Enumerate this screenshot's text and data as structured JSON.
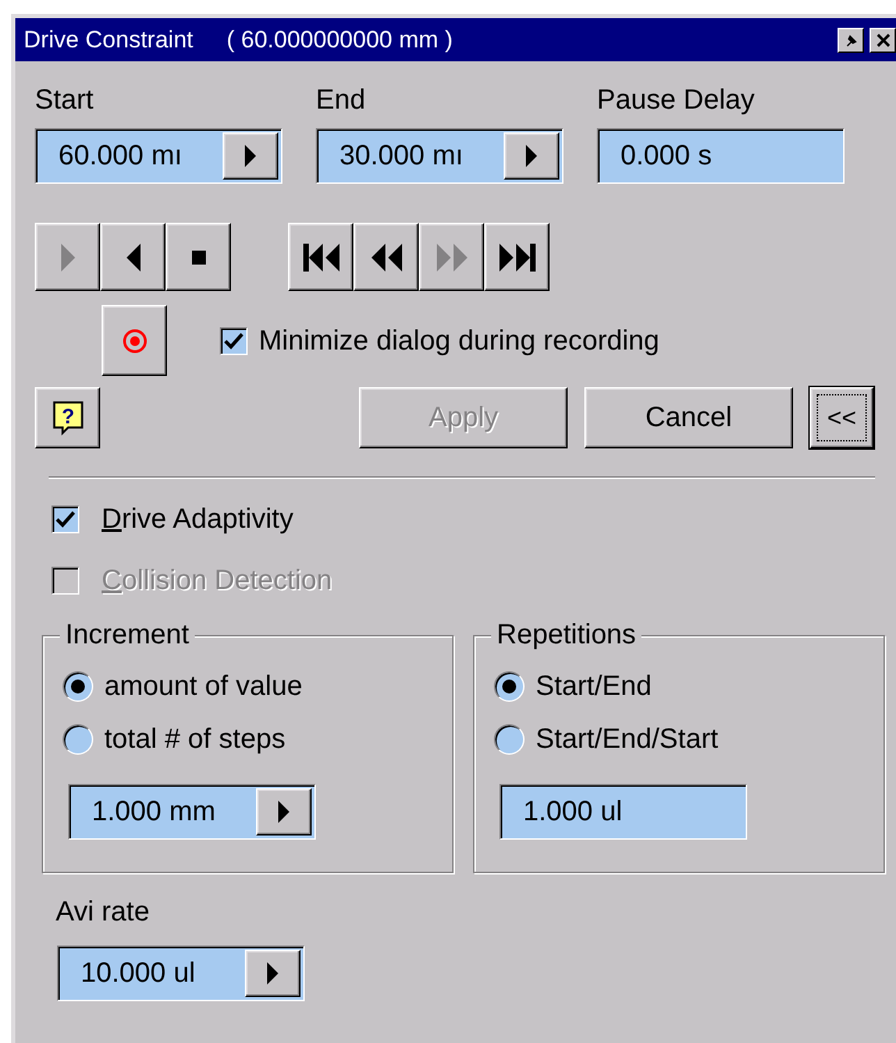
{
  "window": {
    "title": "Drive Constraint",
    "subtitle": "( 60.000000000 mm )"
  },
  "fields": [
    {
      "label": "Start",
      "value": "60.000 mı",
      "kind": "spin"
    },
    {
      "label": "End",
      "value": "30.000 mı",
      "kind": "spin"
    },
    {
      "label": "Pause Delay",
      "value": "0.000 s",
      "kind": "plain"
    }
  ],
  "transport": [
    [
      {
        "kind": "play",
        "disabled": true
      },
      {
        "kind": "reverse",
        "disabled": false
      },
      {
        "kind": "stop",
        "disabled": false
      }
    ],
    [
      {
        "kind": "first",
        "disabled": false
      },
      {
        "kind": "back",
        "disabled": false
      },
      {
        "kind": "forward",
        "disabled": true
      },
      {
        "kind": "last",
        "disabled": false
      }
    ]
  ],
  "record": {
    "label": "Minimize dialog during recording",
    "checked": true
  },
  "buttons": [
    {
      "kind": "help",
      "label": "?"
    },
    {
      "kind": "text",
      "label": "Apply",
      "disabled": true
    },
    {
      "kind": "text",
      "label": "Cancel",
      "disabled": false
    },
    {
      "kind": "text",
      "label": "<<",
      "disabled": false
    }
  ],
  "options": [
    {
      "label": "Drive Adaptivity",
      "checked": true,
      "disabled": false
    },
    {
      "label": "Collision Detection",
      "checked": false,
      "disabled": true
    }
  ],
  "groups": [
    {
      "title": "Increment",
      "radios": [
        {
          "label": "amount of value",
          "selected": true
        },
        {
          "label": "total # of steps",
          "selected": false
        }
      ],
      "field": {
        "value": "1.000 mm",
        "kind": "spin"
      }
    },
    {
      "title": "Repetitions",
      "radios": [
        {
          "label": "Start/End",
          "selected": true
        },
        {
          "label": "Start/End/Start",
          "selected": false
        }
      ],
      "field": {
        "value": "1.000 ul",
        "kind": "plain"
      }
    }
  ],
  "avi": {
    "label": "Avi rate",
    "field": {
      "value": "10.000 ul",
      "kind": "spin"
    }
  }
}
